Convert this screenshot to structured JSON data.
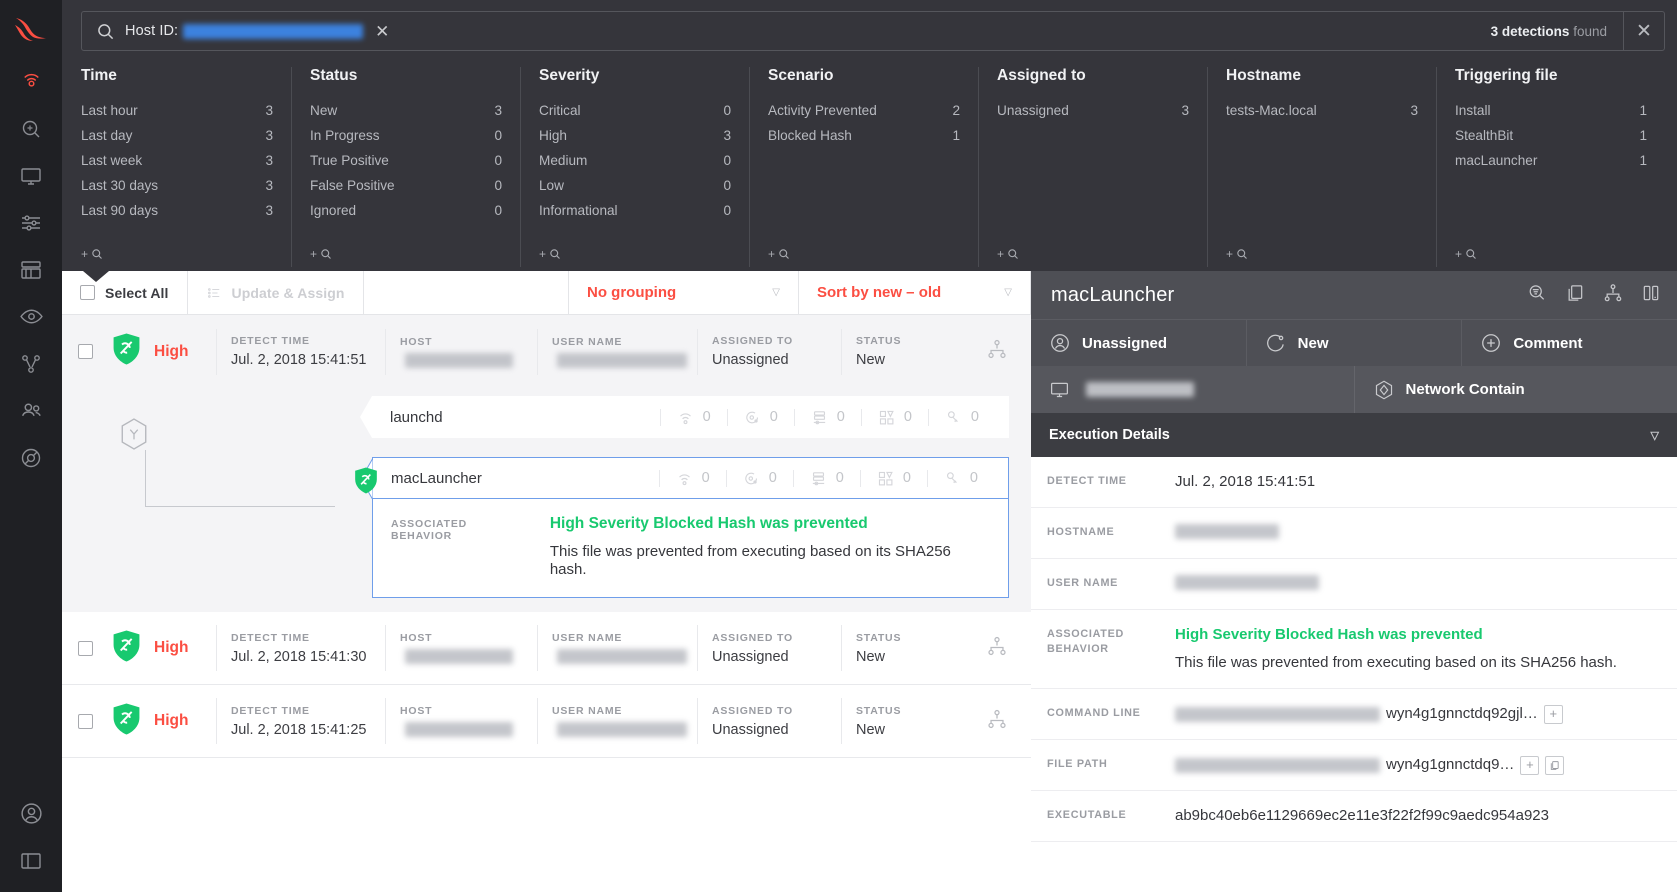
{
  "colors": {
    "accent": "#fb4e42",
    "green": "#18c96f",
    "dark": "#35353b",
    "panel": "#4e4f55"
  },
  "rail": {
    "logo": "falcon-logo",
    "items": [
      {
        "name": "activity",
        "icon": "radar-icon",
        "active": true
      },
      {
        "name": "investigate",
        "icon": "magnifier-circle-icon",
        "active": false
      },
      {
        "name": "hosts",
        "icon": "monitor-icon",
        "active": false
      },
      {
        "name": "configuration",
        "icon": "sliders-icon",
        "active": false
      },
      {
        "name": "dashboards",
        "icon": "library-icon",
        "active": false
      },
      {
        "name": "discover",
        "icon": "eye-icon",
        "active": false
      },
      {
        "name": "intelligence",
        "icon": "branch-icon",
        "active": false
      },
      {
        "name": "users",
        "icon": "people-icon",
        "active": false
      },
      {
        "name": "support",
        "icon": "lifebuoy-icon",
        "active": false
      }
    ],
    "bottom": [
      {
        "name": "account",
        "icon": "user-circle-icon"
      },
      {
        "name": "collapse",
        "icon": "panel-icon"
      }
    ]
  },
  "search": {
    "icon": "search-icon",
    "label": "Host ID:",
    "value_redacted": true,
    "value_width": 180,
    "clear_glyph": "✕",
    "results_count": "3 detections",
    "results_suffix": "found",
    "close_glyph": "✕"
  },
  "facets": [
    {
      "title": "Time",
      "add": "+",
      "add_icon": "search-icon",
      "rows": [
        {
          "label": "Last hour",
          "value": "3"
        },
        {
          "label": "Last day",
          "value": "3"
        },
        {
          "label": "Last week",
          "value": "3"
        },
        {
          "label": "Last 30 days",
          "value": "3"
        },
        {
          "label": "Last 90 days",
          "value": "3"
        }
      ]
    },
    {
      "title": "Status",
      "add": "+",
      "add_icon": "search-icon",
      "rows": [
        {
          "label": "New",
          "value": "3"
        },
        {
          "label": "In Progress",
          "value": "0"
        },
        {
          "label": "True Positive",
          "value": "0"
        },
        {
          "label": "False Positive",
          "value": "0"
        },
        {
          "label": "Ignored",
          "value": "0"
        }
      ]
    },
    {
      "title": "Severity",
      "add": "+",
      "add_icon": "search-icon",
      "rows": [
        {
          "label": "Critical",
          "value": "0"
        },
        {
          "label": "High",
          "value": "3"
        },
        {
          "label": "Medium",
          "value": "0"
        },
        {
          "label": "Low",
          "value": "0"
        },
        {
          "label": "Informational",
          "value": "0"
        }
      ]
    },
    {
      "title": "Scenario",
      "add": "+",
      "add_icon": "search-icon",
      "rows": [
        {
          "label": "Activity Prevented",
          "value": "2"
        },
        {
          "label": "Blocked Hash",
          "value": "1"
        }
      ]
    },
    {
      "title": "Assigned to",
      "add": "+",
      "add_icon": "search-icon",
      "rows": [
        {
          "label": "Unassigned",
          "value": "3"
        }
      ]
    },
    {
      "title": "Hostname",
      "add": "+",
      "add_icon": "search-icon",
      "rows": [
        {
          "label": "tests-Mac.local",
          "value": "3"
        }
      ]
    },
    {
      "title": "Triggering file",
      "add": "+",
      "add_icon": "search-icon",
      "rows": [
        {
          "label": "Install",
          "value": "1"
        },
        {
          "label": "StealthBit",
          "value": "1"
        },
        {
          "label": "macLauncher",
          "value": "1"
        }
      ]
    }
  ],
  "toolbar": {
    "select_all": "Select All",
    "update_assign": "Update & Assign",
    "update_assign_icon": "list-icon",
    "grouping": "No grouping",
    "sort": "Sort by new – old",
    "caret_glyph": "▽"
  },
  "list": {
    "headers": {
      "detect_time": "DETECT TIME",
      "host": "HOST",
      "user_name": "USER NAME",
      "assigned_to": "ASSIGNED TO",
      "status": "STATUS"
    },
    "rows": [
      {
        "severity": "High",
        "severity_icon": "prevention-shield-icon",
        "detect_time": "Jul. 2, 2018 15:41:51",
        "host_redacted": true,
        "user_redacted": true,
        "assigned_to": "Unassigned",
        "status": "New",
        "tree_icon": "process-tree-icon",
        "selected": true
      },
      {
        "severity": "High",
        "severity_icon": "prevention-shield-icon",
        "detect_time": "Jul. 2, 2018 15:41:30",
        "host_redacted": true,
        "user_redacted": true,
        "assigned_to": "Unassigned",
        "status": "New",
        "tree_icon": "process-tree-icon",
        "selected": false
      },
      {
        "severity": "High",
        "severity_icon": "prevention-shield-icon",
        "detect_time": "Jul. 2, 2018 15:41:25",
        "host_redacted": true,
        "user_redacted": true,
        "assigned_to": "Unassigned",
        "status": "New",
        "tree_icon": "process-tree-icon",
        "selected": false
      }
    ]
  },
  "tree": {
    "root_icon": "hexagon-y-icon",
    "parent": {
      "name": "launchd",
      "counts": [
        "0",
        "0",
        "0",
        "0",
        "0"
      ]
    },
    "child": {
      "name": "macLauncher",
      "counts": [
        "0",
        "0",
        "0",
        "0",
        "0"
      ],
      "shield_icon": "prevention-shield-icon"
    },
    "count_icons": [
      "wifi-icon",
      "dns-target-icon",
      "registry-icon",
      "modules-grid-icon",
      "key-icon"
    ],
    "behavior_header": "ASSOCIATED BEHAVIOR",
    "behavior_title": "High Severity Blocked Hash was prevented",
    "behavior_desc": "This file was prevented from executing based on its SHA256 hash."
  },
  "detail": {
    "title": "macLauncher",
    "head_icons": [
      "search-filter-icon",
      "copy-icon",
      "share-graph-icon",
      "device-icon"
    ],
    "actions": [
      {
        "label": "Unassigned",
        "icon": "user-circle-icon"
      },
      {
        "label": "New",
        "icon": "status-circle-icon"
      },
      {
        "label": "Comment",
        "icon": "plus-circle-icon"
      }
    ],
    "subactions": [
      {
        "label_redacted": true,
        "label": "tests-Mac.local",
        "icon": "monitor-icon"
      },
      {
        "label": "Network Contain",
        "icon": "hex-contain-icon"
      }
    ],
    "section_title": "Execution Details",
    "section_caret": "▽",
    "fields": [
      {
        "key": "DETECT TIME",
        "value": "Jul. 2, 2018 15:41:51",
        "redacted": false
      },
      {
        "key": "HOSTNAME",
        "value": "tests-Mac.local",
        "redacted": true,
        "redact_width": 104
      },
      {
        "key": "USER NAME",
        "value": "test@tests-Mac.local",
        "redacted": true,
        "redact_width": 144
      },
      {
        "key": "ASSOCIATED BEHAVIOR",
        "value_green": "High Severity Blocked Hash was prevented",
        "value": "This file was prevented from executing based on its SHA256 hash.",
        "redacted": false
      },
      {
        "key": "COMMAND LINE",
        "value": "wyn4g1gnnctdq92gjl…",
        "redacted": true,
        "redact_width": 205,
        "button": "+"
      },
      {
        "key": "FILE PATH",
        "value": "wyn4g1gnnctdq9…",
        "redacted": true,
        "redact_width": 205,
        "buttons": [
          "+",
          "copy-icon"
        ]
      },
      {
        "key": "EXECUTABLE",
        "value": "ab9bc40eb6e1129669ec2e11e3f22f2f99c9aedc954a923",
        "redacted": false
      }
    ]
  }
}
